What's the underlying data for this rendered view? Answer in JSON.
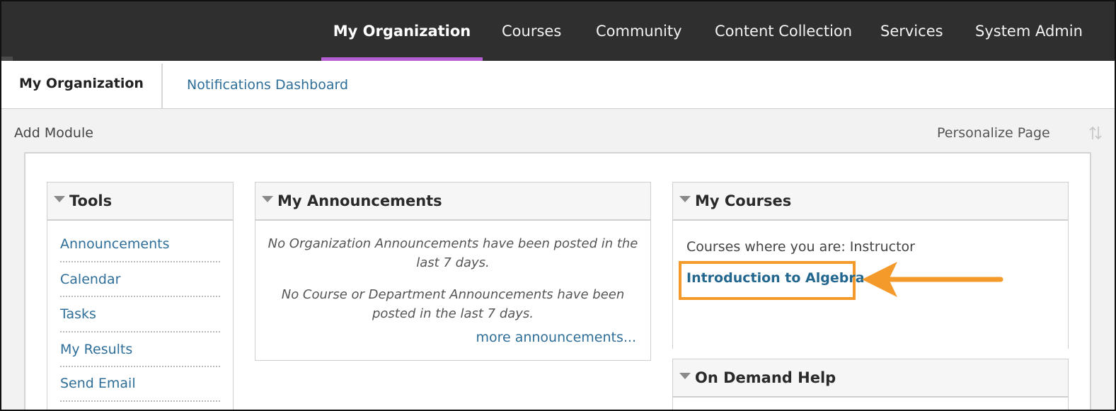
{
  "top_nav": {
    "items": [
      {
        "label": "My Organization",
        "active": true
      },
      {
        "label": "Courses",
        "active": false
      },
      {
        "label": "Community",
        "active": false
      },
      {
        "label": "Content Collection",
        "active": false
      },
      {
        "label": "Services",
        "active": false
      },
      {
        "label": "System Admin",
        "active": false
      }
    ]
  },
  "sub_nav": {
    "current": "My Organization",
    "link": "Notifications Dashboard"
  },
  "action_bar": {
    "add_module": "Add Module",
    "personalize": "Personalize Page",
    "reorder_icon": "reorder-arrows-icon"
  },
  "modules": {
    "tools": {
      "title": "Tools",
      "items": [
        "Announcements",
        "Calendar",
        "Tasks",
        "My Results",
        "Send Email"
      ]
    },
    "announcements": {
      "title": "My Announcements",
      "org_message": "No Organization Announcements have been posted in the last 7 days.",
      "course_message": "No Course or Department Announcements have been posted in the last 7 days.",
      "more_link": "more announcements..."
    },
    "courses": {
      "title": "My Courses",
      "role_label": "Courses where you are: Instructor",
      "course_name": "Introduction to Algebra"
    },
    "help": {
      "title": "On Demand Help"
    }
  },
  "colors": {
    "accent_underline": "#b65fd4",
    "link": "#2e6e98",
    "highlight": "#f39a2b",
    "topbar": "#2f2f2f"
  }
}
